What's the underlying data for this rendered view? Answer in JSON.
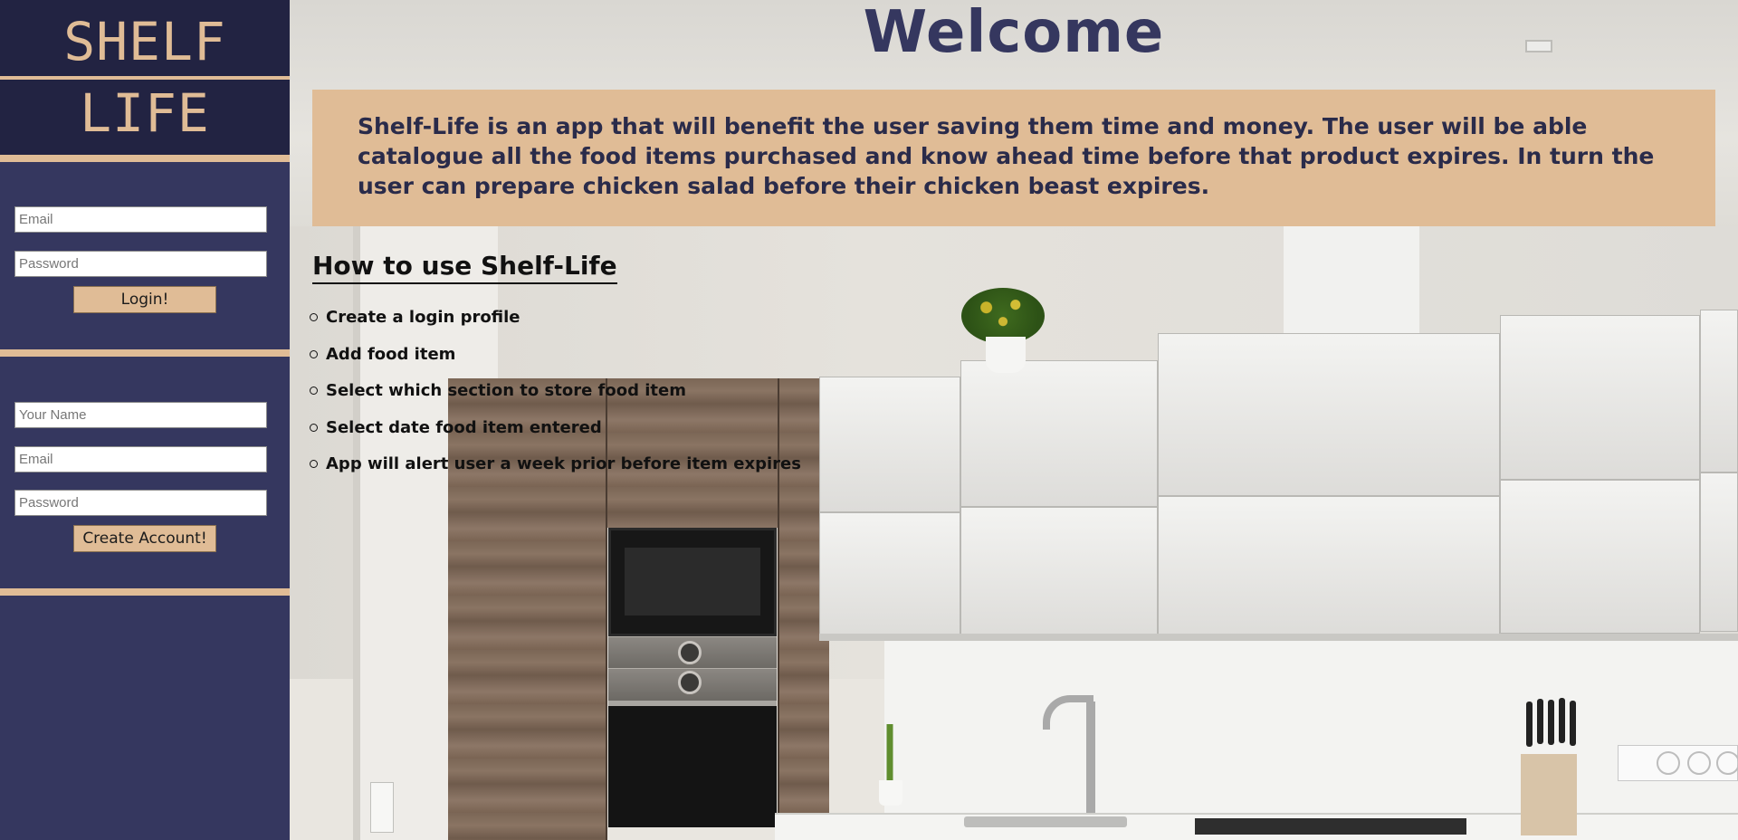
{
  "sidebar": {
    "logo_line_1": "SHELF",
    "logo_line_2": "LIFE",
    "login": {
      "email_placeholder": "Email",
      "password_placeholder": "Password",
      "button_label": "Login!"
    },
    "signup": {
      "name_placeholder": "Your Name",
      "email_placeholder": "Email",
      "password_placeholder": "Password",
      "button_label": "Create Account!"
    }
  },
  "main": {
    "title": "Welcome",
    "intro": "Shelf-Life is an app that will benefit the user saving them time and money. The user will be able catalogue all the food items purchased and know ahead time before that product expires. In turn the user can prepare chicken salad before their chicken beast expires.",
    "howto_heading": "How to use Shelf-Life",
    "steps": [
      "Create a login profile",
      "Add food item",
      "Select which section to store food item",
      "Select date food item entered",
      "App will alert user a week prior before item expires"
    ]
  },
  "colors": {
    "navy": "#35375f",
    "dark_navy": "#222342",
    "tan": "#e0bc96"
  },
  "icons": {
    "background": "kitchen-photo"
  }
}
